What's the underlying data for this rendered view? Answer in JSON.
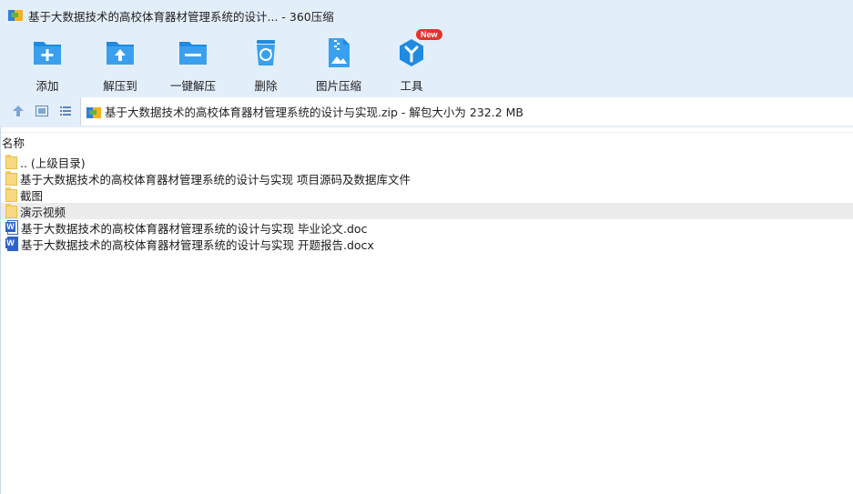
{
  "window": {
    "title": "基于大数据技术的高校体育器材管理系统的设计... - 360压缩"
  },
  "toolbar": {
    "add_label": "添加",
    "extract_to_label": "解压到",
    "one_click_extract_label": "一键解压",
    "delete_label": "删除",
    "image_compress_label": "图片压缩",
    "tools_label": "工具",
    "tools_badge": "New"
  },
  "address": {
    "text": "基于大数据技术的高校体育器材管理系统的设计与实现.zip - 解包大小为 232.2 MB"
  },
  "list": {
    "column_name": "名称",
    "items": [
      {
        "name": ".. (上级目录)",
        "type": "folder"
      },
      {
        "name": "基于大数据技术的高校体育器材管理系统的设计与实现 项目源码及数据库文件",
        "type": "folder"
      },
      {
        "name": "截图",
        "type": "folder"
      },
      {
        "name": "演示视频",
        "type": "folder"
      },
      {
        "name": "基于大数据技术的高校体育器材管理系统的设计与实现 毕业论文.doc",
        "type": "doc"
      },
      {
        "name": "基于大数据技术的高校体育器材管理系统的设计与实现 开题报告.docx",
        "type": "docx"
      }
    ]
  },
  "colors": {
    "chrome_bg": "#e3eefb",
    "accent_blue": "#1f8be0",
    "selected_row": "#ececec",
    "badge_red": "#e5332e"
  }
}
